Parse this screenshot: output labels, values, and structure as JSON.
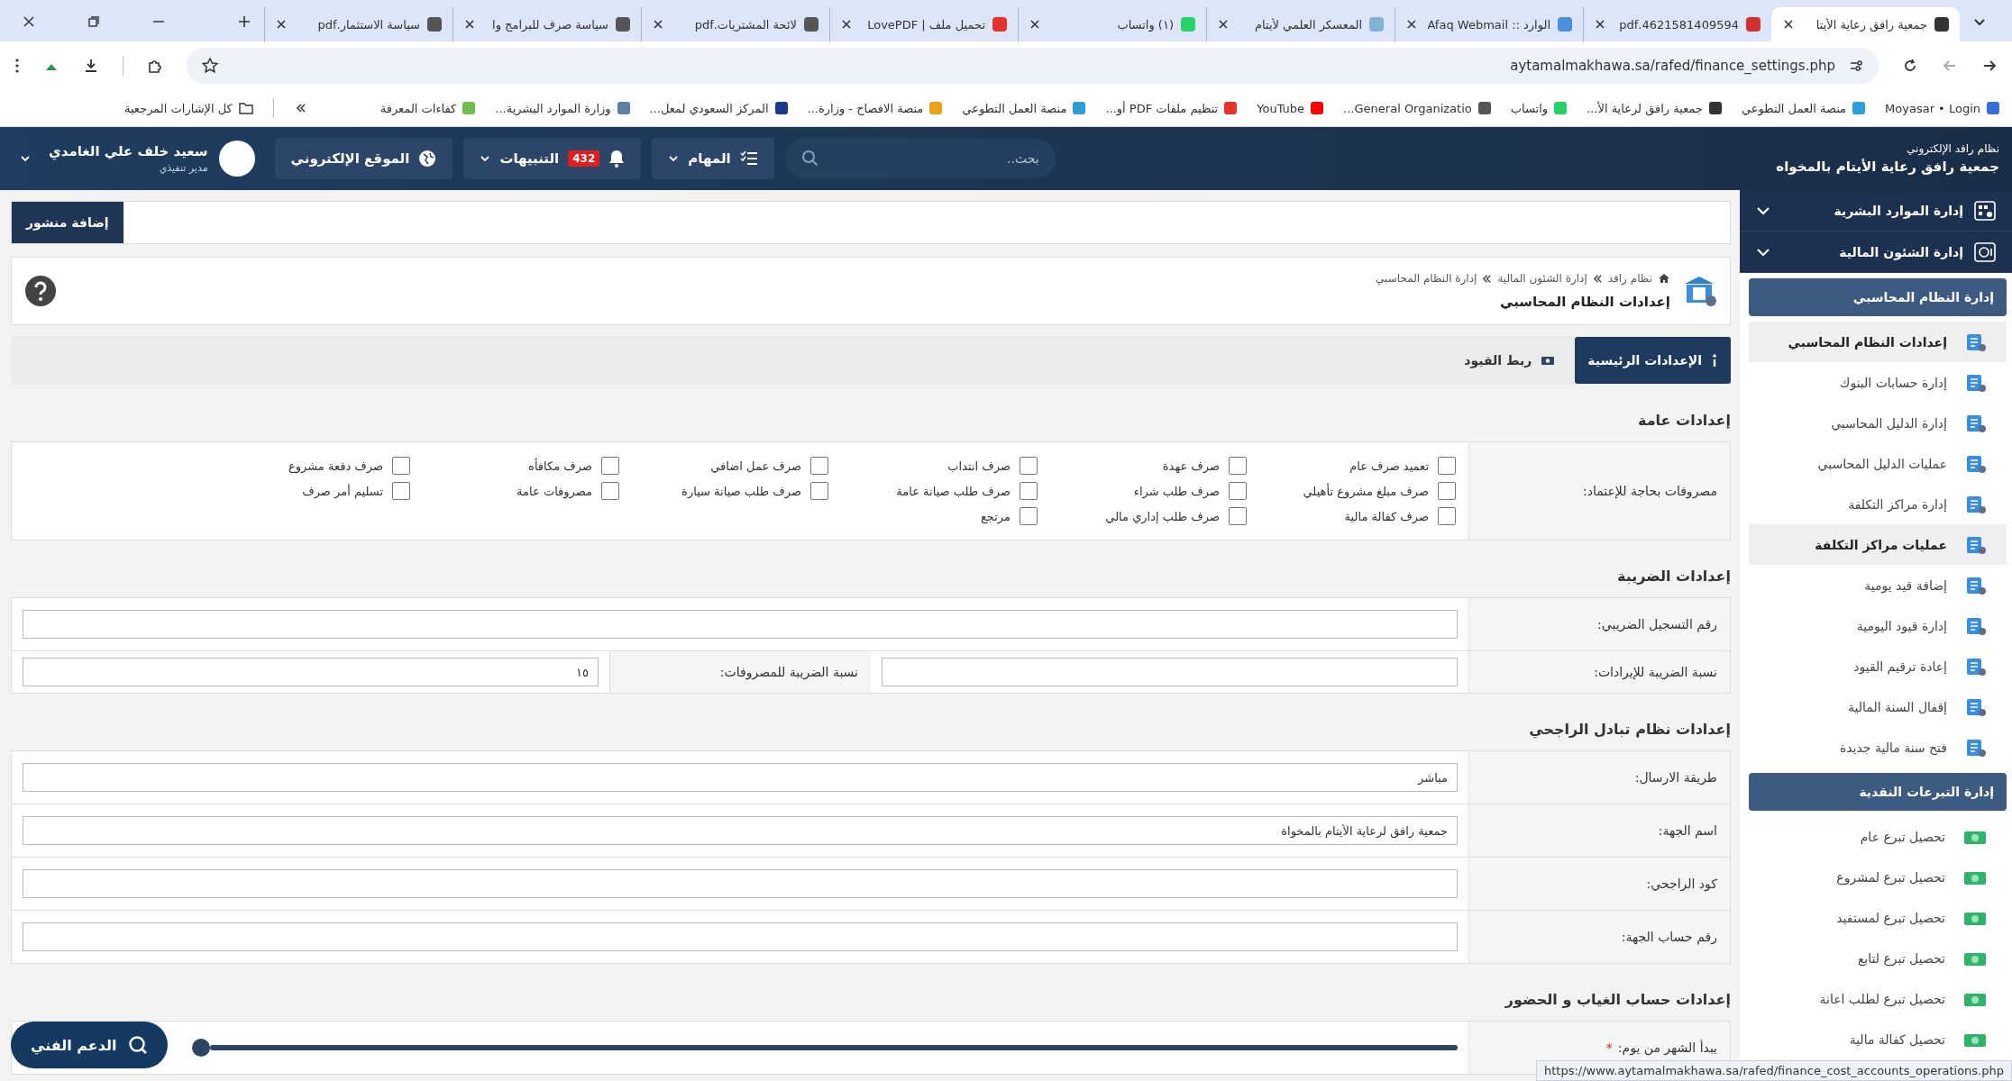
{
  "browser": {
    "tabs": [
      {
        "title": "جمعية رافق رعاية الأيتا",
        "selected": true,
        "color": "#333333"
      },
      {
        "title": "4621581409594.pdf",
        "selected": false,
        "color": "#d32f2f"
      },
      {
        "title": "الوارد :: Afaq Webmail",
        "selected": false,
        "color": "#4a90d9"
      },
      {
        "title": "المعسكر العلمي لأيتام",
        "selected": false,
        "color": "#7fb3d5"
      },
      {
        "title": "(١) واتساب",
        "selected": false,
        "color": "#25d366"
      },
      {
        "title": "تحميل ملف | LovePDF",
        "selected": false,
        "color": "#e5322d"
      },
      {
        "title": "لائحة المشتريات.pdf",
        "selected": false,
        "color": "#555555"
      },
      {
        "title": "سياسة صرف للبرامج وا",
        "selected": false,
        "color": "#555555"
      },
      {
        "title": "سياسة الاستثمار.pdf",
        "selected": false,
        "color": "#555555"
      }
    ],
    "address": "aytamalmakhawa.sa/rafed/finance_settings.php",
    "bookmarks": [
      {
        "label": "Moyasar • Login",
        "color": "#3b6fd8"
      },
      {
        "label": "منصة العمل التطوعي",
        "color": "#2a9fd6"
      },
      {
        "label": "جمعية رافق لرعاية الأ...",
        "color": "#333333"
      },
      {
        "label": "واتساب",
        "color": "#25d366"
      },
      {
        "label": "General Organizatio...",
        "color": "#555555"
      },
      {
        "label": "YouTube",
        "color": "#ff0000"
      },
      {
        "label": "تنظيم ملفات PDF أو...",
        "color": "#e5322d"
      },
      {
        "label": "منصة العمل التطوعي",
        "color": "#2a9fd6"
      },
      {
        "label": "منصة الافصاح - وزارة...",
        "color": "#e8a317"
      },
      {
        "label": "المركز السعودي لمعل...",
        "color": "#1b3b8a"
      },
      {
        "label": "وزارة الموارد البشرية...",
        "color": "#5a7fa8"
      },
      {
        "label": "كفاءات المعرفة",
        "color": "#6cbf4a"
      }
    ],
    "all_bookmarks": "كل الإشارات المرجعية",
    "status_url": "https://www.aytamalmakhawa.sa/rafed/finance_cost_accounts_operations.php"
  },
  "header": {
    "system_name": "نظام رافد الإلكتروني",
    "org_name": "جمعية رافق رعاية الأيتام بالمخواه",
    "search": {
      "placeholder": "بحث.."
    },
    "tasks": "المهام",
    "alerts": {
      "label": "التنبيهات",
      "count": "432"
    },
    "website": "الموقع الإلكتروني",
    "user": {
      "name": "سعيد خلف علي الغامدي",
      "role": "مدير تنفيذي"
    }
  },
  "sidebar": {
    "groups": [
      {
        "label": "إدارة الموارد البشرية",
        "kind": "people"
      },
      {
        "label": "إدارة الشئون المالية",
        "kind": "safe"
      }
    ],
    "sections": [
      {
        "title": "إدارة النظام المحاسبي",
        "kind": "ledger",
        "items": [
          {
            "label": "إعدادات النظام المحاسبي",
            "highlighted": true
          },
          {
            "label": "إدارة حسابات البنوك",
            "highlighted": false
          },
          {
            "label": "إدارة الدليل المحاسبي",
            "highlighted": false
          },
          {
            "label": "عمليات الدليل المحاسبي",
            "highlighted": false
          },
          {
            "label": "إدارة مراكز التكلفة",
            "highlighted": false
          },
          {
            "label": "عمليات مراكز التكلفة",
            "highlighted": true
          },
          {
            "label": "إضافة قيد يومية",
            "highlighted": false
          },
          {
            "label": "إدارة قيود اليومية",
            "highlighted": false
          },
          {
            "label": "إعادة ترقيم القيود",
            "highlighted": false
          },
          {
            "label": "إقفال السنة المالية",
            "highlighted": false
          },
          {
            "label": "فتح سنة مالية جديدة",
            "highlighted": false
          }
        ]
      },
      {
        "title": "إدارة التبرعات النقدية",
        "kind": "donation",
        "items": [
          {
            "label": "تحصيل تبرع عام",
            "highlighted": false
          },
          {
            "label": "تحصيل تبرع لمشروع",
            "highlighted": false
          },
          {
            "label": "تحصيل تبرع لمستفيد",
            "highlighted": false
          },
          {
            "label": "تحصيل تبرع لتابع",
            "highlighted": false
          },
          {
            "label": "تحصيل تبرع لطلب اعانة",
            "highlighted": false
          },
          {
            "label": "تحصيل كفالة مالية",
            "highlighted": false
          }
        ]
      }
    ]
  },
  "main": {
    "add_post": "إضافة منشور",
    "breadcrumb": [
      "نظام رافد",
      "إدارة الشئون المالية",
      "إدارة النظام المحاسبي"
    ],
    "page_title": "إعدادات النظام المحاسبي",
    "tabs": [
      {
        "label": "الإعدادات الرئيسية",
        "selected": true
      },
      {
        "label": "ربط القيود",
        "selected": false
      }
    ],
    "sections": [
      {
        "title": "إعدادات عامة",
        "rows": [
          {
            "kind": "checks",
            "label": "مصروفات بحاجة للإعتماد:",
            "options": [
              {
                "label": "تعميد صرف عام",
                "checked": false
              },
              {
                "label": "صرف عهدة",
                "checked": false
              },
              {
                "label": "صرف انتداب",
                "checked": false
              },
              {
                "label": "صرف عمل اضافي",
                "checked": false
              },
              {
                "label": "صرف مكافأه",
                "checked": false
              },
              {
                "label": "صرف دفعة مشروع",
                "checked": false
              },
              {
                "label": "صرف مبلغ مشروع تأهيلي",
                "checked": false
              },
              {
                "label": "صرف طلب شراء",
                "checked": false
              },
              {
                "label": "صرف طلب صيانة عامة",
                "checked": false
              },
              {
                "label": "صرف طلب صيانة سيارة",
                "checked": false
              },
              {
                "label": "مصروفات عامة",
                "checked": false
              },
              {
                "label": "تسليم أمر صرف",
                "checked": false
              },
              {
                "label": "صرف كفالة مالية",
                "checked": false
              },
              {
                "label": "صرف طلب إداري مالي",
                "checked": false
              },
              {
                "label": "مرتجع",
                "checked": false
              }
            ]
          }
        ]
      },
      {
        "title": "إعدادات الضريبة",
        "rows": [
          {
            "kind": "field",
            "label": "رقم التسجيل الضريبي:"
          },
          {
            "kind": "pair",
            "fields": [
              {
                "label": "نسبة الضريبة للإيرادات:"
              },
              {
                "label": "نسبة الضريبة للمصروفات:",
                "value": "١٥"
              }
            ]
          }
        ]
      },
      {
        "title": "إعدادات نظام تبادل الراجحي",
        "rows": [
          {
            "kind": "field",
            "label": "طريقة الارسال:",
            "value": "مباشر"
          },
          {
            "kind": "field",
            "label": "اسم الجهة:",
            "value": "جمعية رافق لرعاية الأيتام بالمخواة"
          },
          {
            "kind": "field",
            "label": "كود الراجحي:"
          },
          {
            "kind": "field",
            "label": "رقم حساب الجهة:"
          }
        ]
      },
      {
        "title": "إعدادات حساب الغياب و الحضور",
        "rows": [
          {
            "kind": "slider",
            "label": "يبدأ الشهر من يوم:",
            "required_mark": "*",
            "level": 1
          }
        ]
      }
    ]
  },
  "support_button": "الدعم الفني"
}
